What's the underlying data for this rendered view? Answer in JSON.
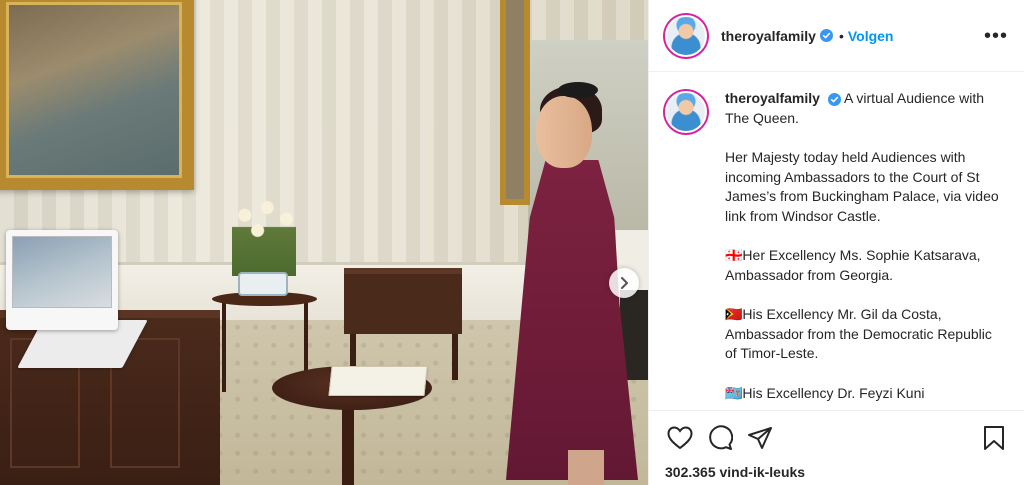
{
  "post": {
    "username": "theroyalfamily",
    "verified": true,
    "follow_label": "Volgen",
    "separator": "•",
    "more_label": "•••"
  },
  "caption": {
    "username": "theroyalfamily",
    "paragraphs": [
      "A virtual Audience with The Queen.",
      "Her Majesty today held Audiences with incoming Ambassadors to the Court of St James’s from Buckingham Palace, via video link from Windsor Castle.",
      "🇬🇪Her Excellency Ms. Sophie Katsarava, Ambassador from Georgia.",
      "🇹🇱His Excellency Mr. Gil da Costa, Ambassador from the Democratic Republic of Timor-Leste.",
      "🇫🇯His Excellency Dr. Feyzi Kuni"
    ]
  },
  "actions": {
    "like": "heart-icon",
    "comment": "comment-icon",
    "share": "share-icon",
    "save": "bookmark-icon"
  },
  "likes_text": "302.365 vind-ik-leuks",
  "colors": {
    "accent": "#0095f6",
    "text": "#262626",
    "border": "#efefef",
    "verified": "#3897f0"
  }
}
